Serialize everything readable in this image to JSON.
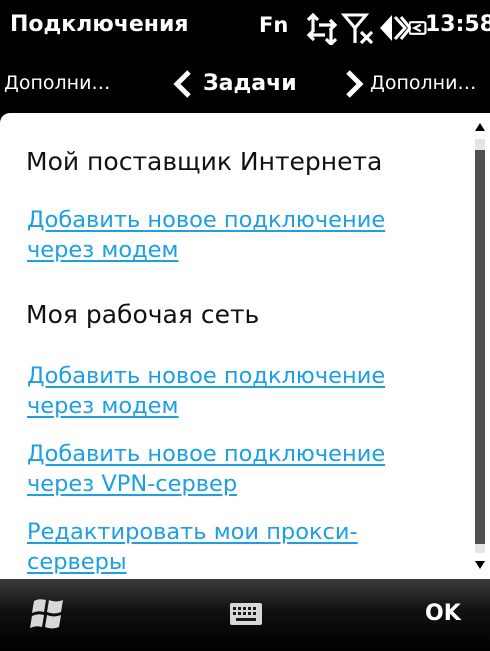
{
  "status_bar": {
    "title": "Подключения",
    "fn_label": "Fn",
    "time": "13:58",
    "icons": [
      "data-sync-icon",
      "signal-off-icon",
      "speaker-off-icon",
      "battery-charging-icon"
    ]
  },
  "tabs": {
    "left_label": "Дополни…",
    "center_label": "Задачи",
    "right_label": "Дополни…"
  },
  "sections": [
    {
      "heading": "Мой поставщик Интернета",
      "links": [
        {
          "line1": "Добавить новое подключение",
          "line2": "через модем"
        }
      ]
    },
    {
      "heading": "Моя рабочая сеть",
      "links": [
        {
          "line1": "Добавить новое подключение",
          "line2": "через модем"
        },
        {
          "line1": "Добавить новое подключение",
          "line2": "через VPN-сервер"
        },
        {
          "line1": "Редактировать мои прокси-",
          "line2": "серверы"
        }
      ]
    }
  ],
  "softkeys": {
    "start_icon": "windows-flag-icon",
    "keyboard_icon": "keyboard-icon",
    "right_label": "OK"
  },
  "colors": {
    "link": "#1d9fe4",
    "background": "#ffffff",
    "chrome": "#000000",
    "scroll_thumb": "#4e4e4e"
  }
}
